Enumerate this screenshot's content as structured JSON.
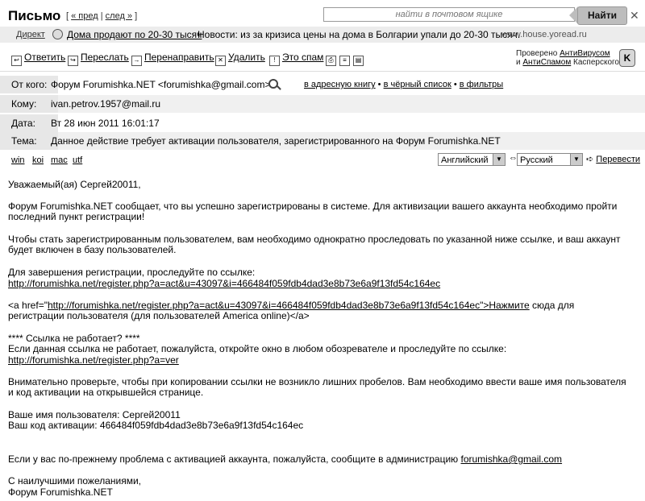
{
  "header": {
    "title": "Письмо",
    "nav_open": "[ ",
    "prev": "« пред",
    "nav_sep": " | ",
    "next": "след »",
    "nav_close": " ]",
    "search_placeholder": "найти в почтовом ящике",
    "find_button": "Найти",
    "close": "✕"
  },
  "ad": {
    "direct": "Директ",
    "link": "Дома продают по 20-30 тысяч",
    "text": "Новости: из за кризиса цены на дома в Болгарии упали до 20-30 тысяч.",
    "url": "www.house.yoread.ru"
  },
  "toolbar": {
    "reply": "Ответить",
    "forward": "Переслать",
    "redirect": "Перенаправить",
    "delete": "Удалить",
    "spam": "Это спам",
    "kaspersky_line1_prefix": "Проверено ",
    "kaspersky_antivirus": "АнтиВирусом",
    "kaspersky_line2_prefix": "и ",
    "kaspersky_antispam": "АнтиСпамом",
    "kaspersky_line2_suffix": " Касперского",
    "kaspersky_logo": "K"
  },
  "meta": {
    "from_label": "От кого:",
    "from_value": "Форум Forumishka.NET <forumishka@gmail.com>",
    "add_book": "в адресную книгу",
    "blacklist": "в чёрный список",
    "filters": "в фильтры",
    "bullet": " • ",
    "to_label": "Кому:",
    "to_value": "ivan.petrov.1957@mail.ru",
    "date_label": "Дата:",
    "date_value": "Вт 28 июн 2011 16:01:17",
    "subject_label": "Тема:",
    "subject_value": "Данное действие требует активации пользователя, зарегистрированного на Форум Forumishka.NET"
  },
  "encoding": {
    "win": "win",
    "koi": "koi",
    "mac": "mac",
    "utf": "utf",
    "from_lang": "Английский",
    "to_lang": "Русский",
    "swap": "⇔",
    "translate": "Перевести"
  },
  "body": {
    "greeting": "Уважаемый(ая) Сергей20011,",
    "p1": "Форум Forumishka.NET сообщает, что вы успешно зарегистрированы в системе. Для активизации вашего аккаунта необходимо пройти последний пункт регистрации!",
    "p2": "Чтобы стать зарегистрированным пользователем, вам необходимо однократно проследовать по указанной ниже ссылке, и ваш аккаунт будет включен в базу пользователей.",
    "p3": "Для завершения регистрации, проследуйте по ссылке:",
    "link1": "http://forumishka.net/register.php?a=act&u=43097&i=466484f059fdb4dad3e8b73e6a9f13fd54c164ec",
    "p4_pre": "<a href=\"",
    "p4_link": "http://forumishka.net/register.php?a=act&u=43097&i=466484f059fdb4dad3e8b73e6a9f13fd54c164ec\">Нажмите",
    "p4_post": " сюда для регистрации пользователя (для пользователей America online)</a>",
    "p5_heading": "**** Ссылка не работает? ****",
    "p5": "Если данная ссылка не работает, пожалуйста, откройте окно в любом обозревателе и проследуйте по ссылке:",
    "link2": "http://forumishka.net/register.php?a=ver",
    "p6": "Внимательно проверьте, чтобы при копировании ссылки не возникло лишних пробелов. Вам необходимо ввести ваше имя пользователя и код активации на открывшейся странице.",
    "username_line": "Ваше имя пользователя: Сергей20011",
    "code_line": "Ваш код активации: 466484f059fdb4dad3e8b73e6a9f13fd54c164ec",
    "p7_pre": "Если у вас по-прежнему проблема с активацией аккаунта, пожалуйста, сообщите в администрацию ",
    "admin_email": "forumishka@gmail.com",
    "closing": "С наилучшими пожеланиями,",
    "signature": "Форум Forumishka.NET"
  }
}
